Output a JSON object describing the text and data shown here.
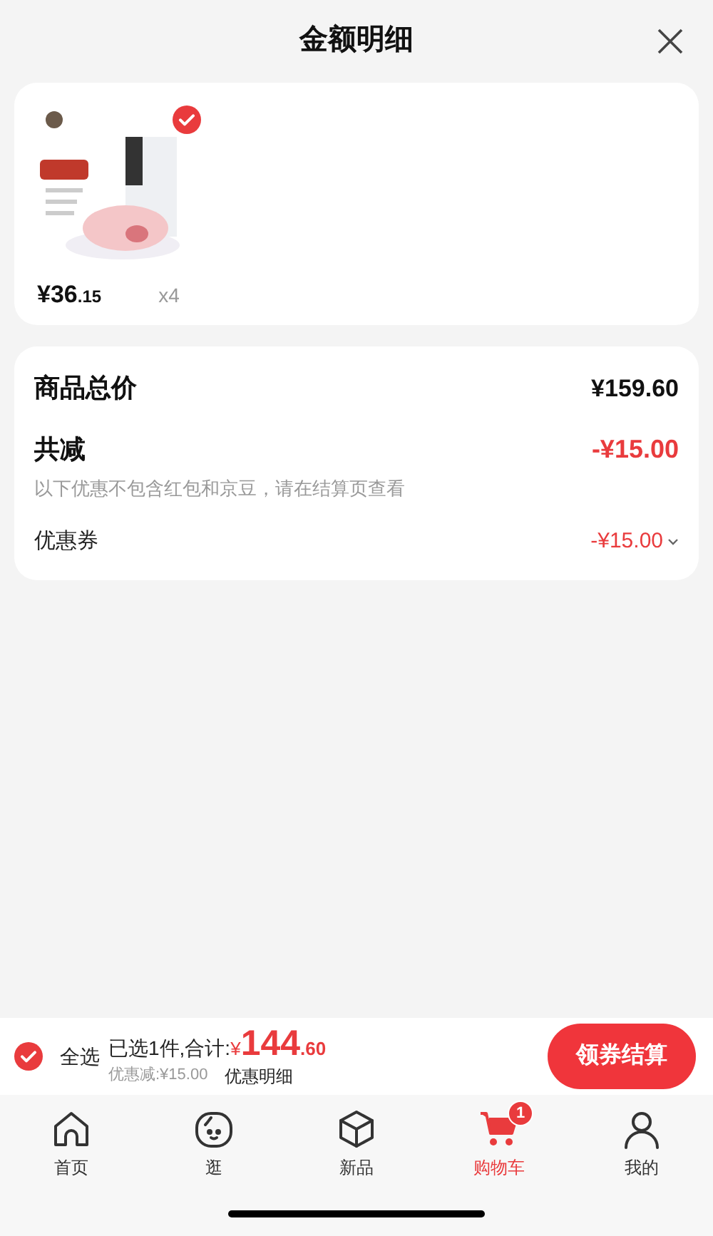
{
  "header": {
    "title": "金额明细"
  },
  "product": {
    "selected": true,
    "price_main": "¥36",
    "price_decimal": ".15",
    "quantity": "x4"
  },
  "summary": {
    "total_label": "商品总价",
    "total_value": "¥159.60",
    "discount_label": "共减",
    "discount_value": "-¥15.00",
    "note": "以下优惠不包含红包和京豆，请在结算页查看",
    "coupon_label": "优惠券",
    "coupon_value": "-¥15.00"
  },
  "checkout": {
    "select_all_checked": true,
    "select_all_label": "全选",
    "selected_text": "已选1件,合计:",
    "currency": "¥",
    "total_integer": "144",
    "total_decimal": ".60",
    "discount_text": "优惠减:¥15.00",
    "detail_link": "优惠明细",
    "button": "领券结算"
  },
  "tabs": [
    {
      "label": "首页",
      "selected": false
    },
    {
      "label": "逛",
      "selected": false
    },
    {
      "label": "新品",
      "selected": false
    },
    {
      "label": "购物车",
      "selected": true,
      "badge": "1"
    },
    {
      "label": "我的",
      "selected": false
    }
  ]
}
